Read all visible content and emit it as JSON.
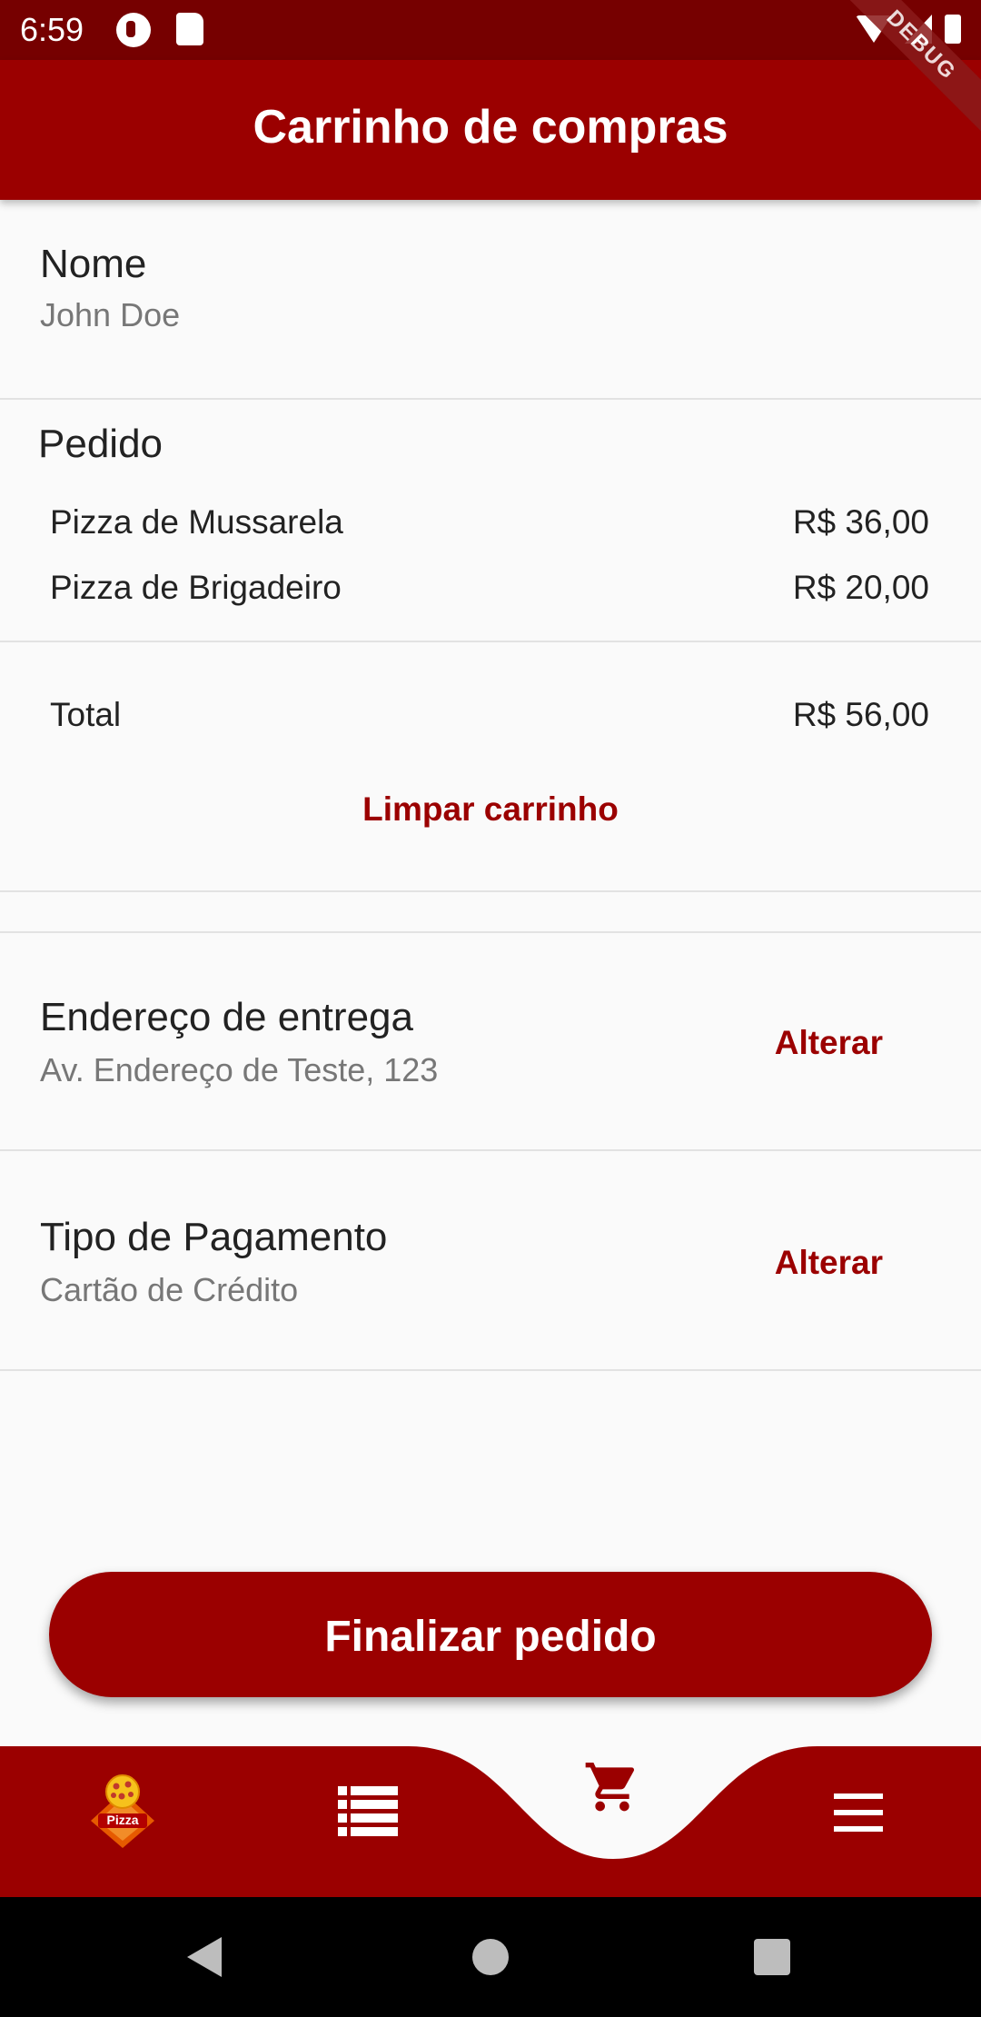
{
  "status_bar": {
    "time": "6:59",
    "icons": [
      "notification-icon",
      "sd-card-icon",
      "wifi-icon",
      "signal-icon",
      "battery-icon"
    ]
  },
  "debug_banner": "DEBUG",
  "app_bar": {
    "title": "Carrinho de compras"
  },
  "customer": {
    "label": "Nome",
    "value": "John Doe"
  },
  "order": {
    "label": "Pedido",
    "items": [
      {
        "name": "Pizza de Mussarela",
        "price": "R$ 36,00"
      },
      {
        "name": "Pizza de Brigadeiro",
        "price": "R$ 20,00"
      }
    ],
    "total_label": "Total",
    "total_value": "R$ 56,00",
    "clear_label": "Limpar carrinho"
  },
  "address": {
    "label": "Endereço de entrega",
    "value": "Av. Endereço de Teste, 123",
    "change_label": "Alterar"
  },
  "payment": {
    "label": "Tipo de Pagamento",
    "value": "Cartão de Crédito",
    "change_label": "Alterar"
  },
  "finish": {
    "label": "Finalizar pedido"
  },
  "logo_text": "Pizza",
  "bottom_nav": {
    "items": [
      "pizza-logo-icon",
      "menu-list-icon",
      "cart-icon",
      "hamburger-menu-icon"
    ],
    "active": "cart-icon"
  },
  "colors": {
    "primary": "#9b0000",
    "status_bar": "#760000",
    "background": "#fafafa",
    "secondary_text": "#777777"
  }
}
